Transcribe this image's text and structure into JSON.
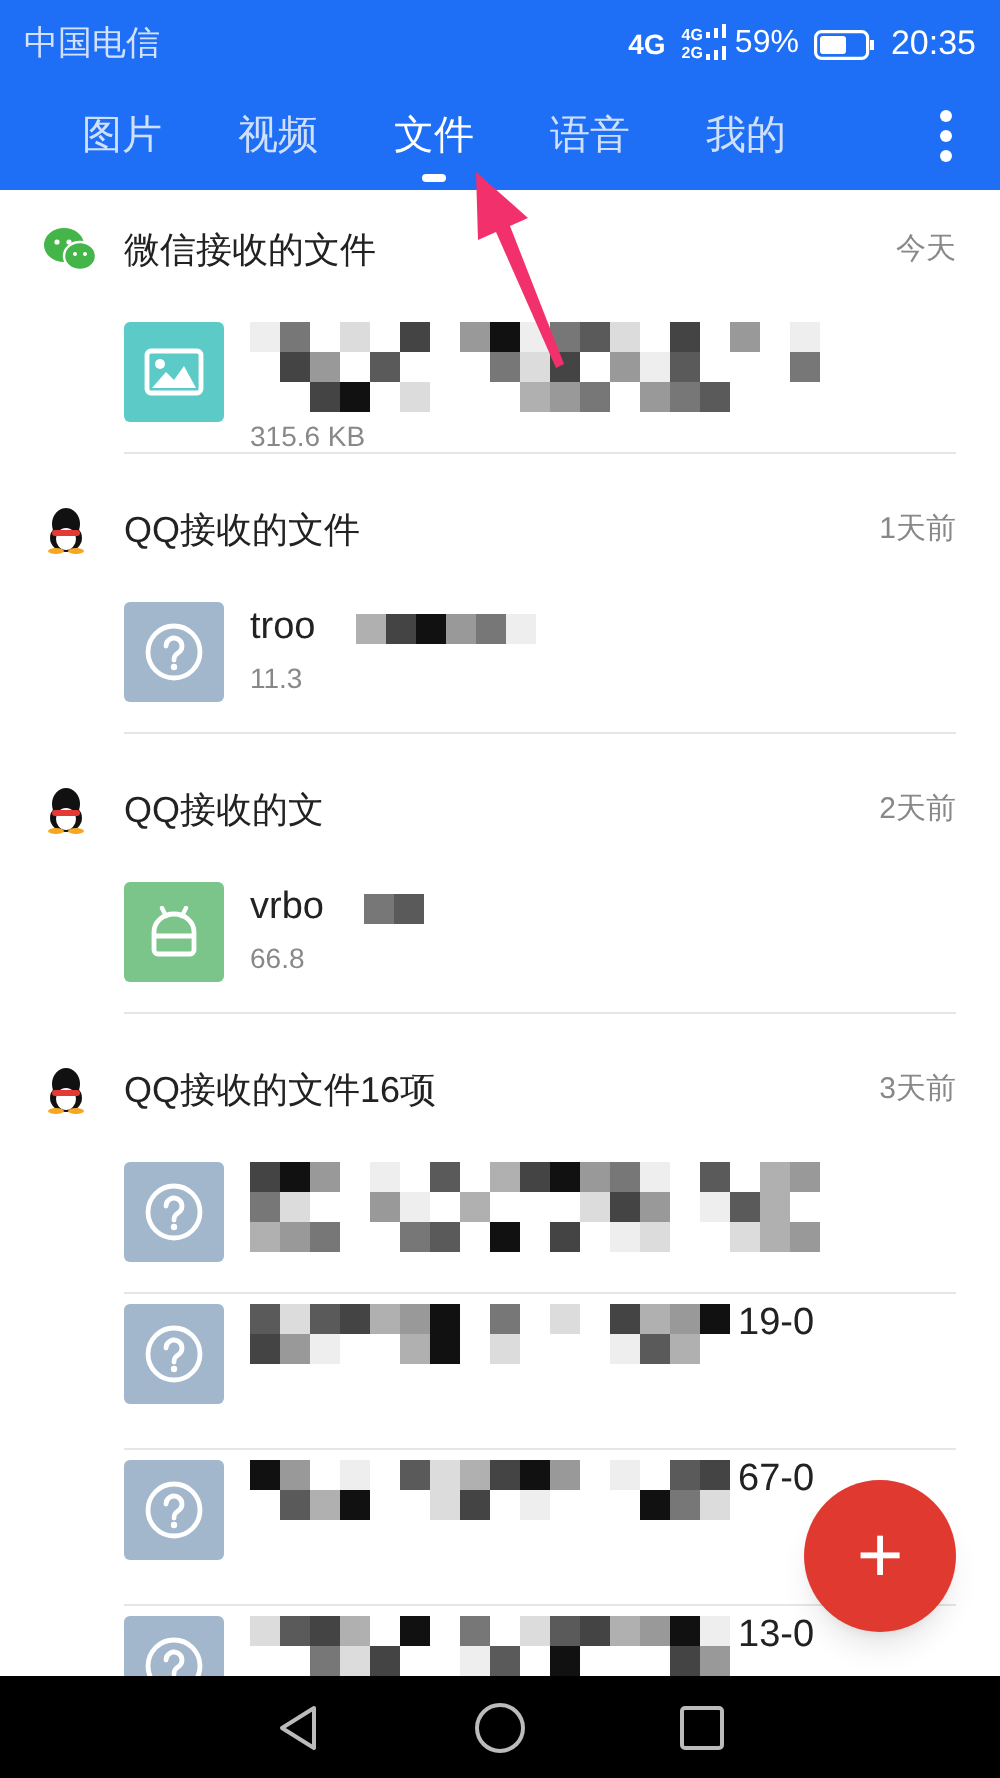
{
  "status_bar": {
    "carrier": "中国电信",
    "network": "4G",
    "network_2": "4G",
    "network_3": "2G",
    "battery": "59%",
    "time": "20:35"
  },
  "tabs": [
    {
      "label": "图片",
      "selected": false
    },
    {
      "label": "视频",
      "selected": false
    },
    {
      "label": "文件",
      "selected": true
    },
    {
      "label": "语音",
      "selected": false
    },
    {
      "label": "我的",
      "selected": false
    }
  ],
  "sections": [
    {
      "kind": "wechat",
      "title": "微信接收的文件",
      "date": "今天",
      "items": [
        {
          "kind": "image",
          "size": "315.6 KB"
        }
      ]
    },
    {
      "kind": "qq",
      "title": "QQ接收的文件",
      "date": "1天前",
      "items": [
        {
          "kind": "unknown",
          "name": "troo",
          "size": "11.3"
        }
      ]
    },
    {
      "kind": "qq",
      "title": "QQ接收的文",
      "date": "2天前",
      "items": [
        {
          "kind": "apk",
          "name": "vrbo",
          "size": "66.8"
        }
      ]
    },
    {
      "kind": "qq",
      "title": "QQ接收的文件16项",
      "date": "3天前",
      "items": [
        {
          "kind": "unknown"
        },
        {
          "kind": "unknown",
          "tail": "19-0"
        },
        {
          "kind": "unknown",
          "tail": "67-0"
        },
        {
          "kind": "unknown",
          "tail": "13-0"
        }
      ]
    }
  ],
  "fab": {
    "label": "+"
  }
}
